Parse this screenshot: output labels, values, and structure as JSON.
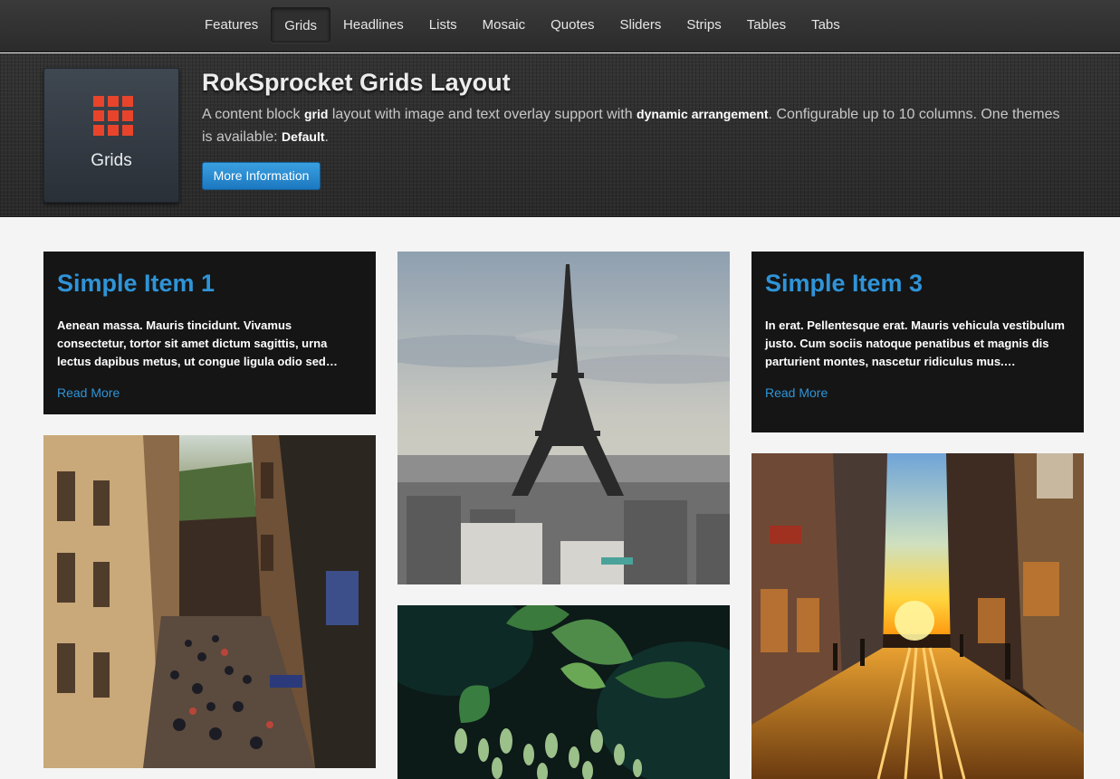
{
  "nav": {
    "items": [
      "Features",
      "Grids",
      "Headlines",
      "Lists",
      "Mosaic",
      "Quotes",
      "Sliders",
      "Strips",
      "Tables",
      "Tabs"
    ],
    "active": "Grids"
  },
  "hero": {
    "icon_label": "Grids",
    "title": "RokSprocket Grids Layout",
    "desc_part1": "A content block ",
    "desc_b1": "grid",
    "desc_part2": " layout with image and text overlay support with ",
    "desc_b2": "dynamic arrangement",
    "desc_part3": ". Configurable up to 10 columns. One themes is available: ",
    "desc_b3": "Default",
    "desc_part4": ".",
    "button": "More Information"
  },
  "grid": {
    "item1": {
      "title": "Simple Item 1",
      "text": "Aenean massa. Mauris tincidunt. Vivamus consectetur, tortor sit amet dictum sagittis, urna lectus dapibus metus, ut congue ligula odio sed…",
      "link": "Read More"
    },
    "item3": {
      "title": "Simple Item 3",
      "text": "In erat. Pellentesque erat. Mauris vehicula vestibulum justo. Cum sociis natoque penatibus et magnis dis parturient montes, nascetur ridiculus mus.…",
      "link": "Read More"
    }
  },
  "colors": {
    "accent": "#2f94d8",
    "icon_red": "#e8442b",
    "card_bg": "#151515"
  }
}
